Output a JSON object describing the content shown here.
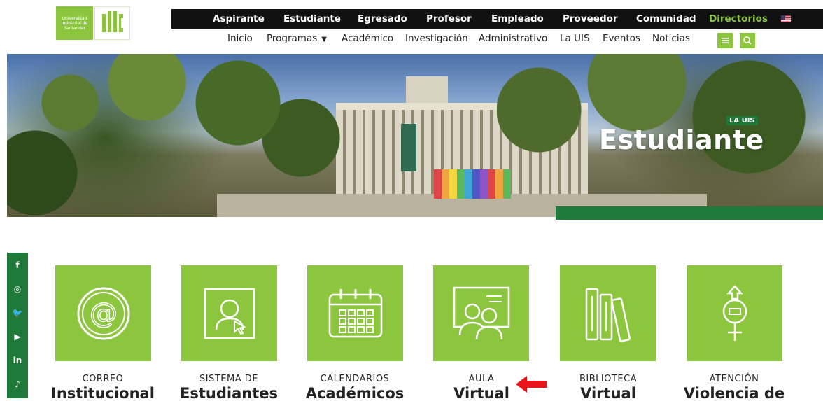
{
  "logo": {
    "line1": "Universidad",
    "line2": "Industrial de",
    "line3": "Santander"
  },
  "topbar": {
    "items": [
      "Aspirante",
      "Estudiante",
      "Egresado",
      "Profesor",
      "Empleado",
      "Proveedor",
      "Comunidad",
      "Directorios"
    ],
    "active": "Estudiante"
  },
  "subnav": {
    "items": [
      "Inicio",
      "Programas",
      "Académico",
      "Investigación",
      "Administrativo",
      "La UIS",
      "Eventos",
      "Noticias"
    ]
  },
  "hero": {
    "tag": "LA UIS",
    "title": "Estudiante"
  },
  "social": {
    "icons": [
      "facebook-icon",
      "instagram-icon",
      "twitter-icon",
      "youtube-icon",
      "linkedin-icon",
      "tiktok-icon"
    ],
    "glyphs": [
      "f",
      "◎",
      "🐦",
      "▶",
      "in",
      "♪"
    ]
  },
  "tiles": [
    {
      "small": "CORREO",
      "big": "Institucional",
      "icon": "at-sign-icon"
    },
    {
      "small": "SISTEMA DE",
      "big": "Estudiantes",
      "icon": "student-system-icon"
    },
    {
      "small": "CALENDARIOS",
      "big": "Académicos",
      "icon": "calendar-icon"
    },
    {
      "small": "AULA",
      "big": "Virtual",
      "icon": "virtual-classroom-icon"
    },
    {
      "small": "BIBLIOTECA",
      "big": "Virtual",
      "icon": "library-books-icon"
    },
    {
      "small": "ATENCIÓN",
      "big": "Violencia de",
      "icon": "gender-symbol-icon"
    }
  ],
  "colors": {
    "brand_green": "#8cc63f",
    "dark_green": "#1f7a3a",
    "topbar": "#111111",
    "arrow": "#e8161b"
  }
}
